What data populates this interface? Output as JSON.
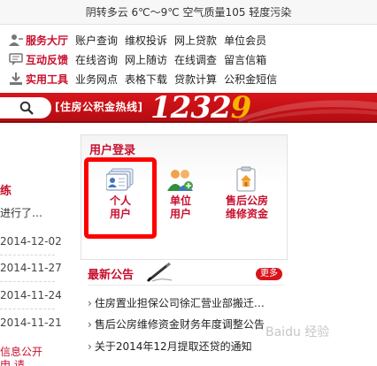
{
  "weather": "阴转多云 6℃～9℃ 空气质量105 轻度污染",
  "services": [
    {
      "category": "服务大厅",
      "icon": "person-icon",
      "links": [
        "账户查询",
        "维权投诉",
        "网上贷款",
        "单位会员"
      ]
    },
    {
      "category": "互动反馈",
      "icon": "chat-icon",
      "links": [
        "在线咨询",
        "网上随访",
        "在线调查",
        "留言信箱"
      ]
    },
    {
      "category": "实用工具",
      "icon": "download-icon",
      "links": [
        "业务网点",
        "表格下载",
        "贷款计算",
        "公积金短信"
      ]
    }
  ],
  "banner": {
    "hotline_label": "[住房公积金热线]",
    "number_prefix": "1232",
    "number_suffix": "9",
    "accent_color": "#d9141b"
  },
  "left": {
    "heading": "练",
    "subtext": "进行了…",
    "dates": [
      "2014-12-02",
      "2014-11-27",
      "2014-11-24",
      "2014-11-21"
    ],
    "info_open": "信息公开",
    "info_sub": "申 请"
  },
  "login": {
    "title": "用户登录",
    "tiles": [
      {
        "line1": "个人",
        "line2": "用户",
        "icon": "id-card-icon"
      },
      {
        "line1": "单位",
        "line2": "用户",
        "icon": "users-add-icon"
      },
      {
        "line1": "售后公房",
        "line2": "维修资金",
        "icon": "house-icon"
      }
    ]
  },
  "announcements": {
    "title": "最新公告",
    "more": "更多",
    "items": [
      "住房置业担保公司徐汇营业部搬迁…",
      "售后公房维修资金财务年度调整公告",
      "关于2014年12月提取还贷的通知"
    ]
  },
  "watermark": "Baidu 经验"
}
